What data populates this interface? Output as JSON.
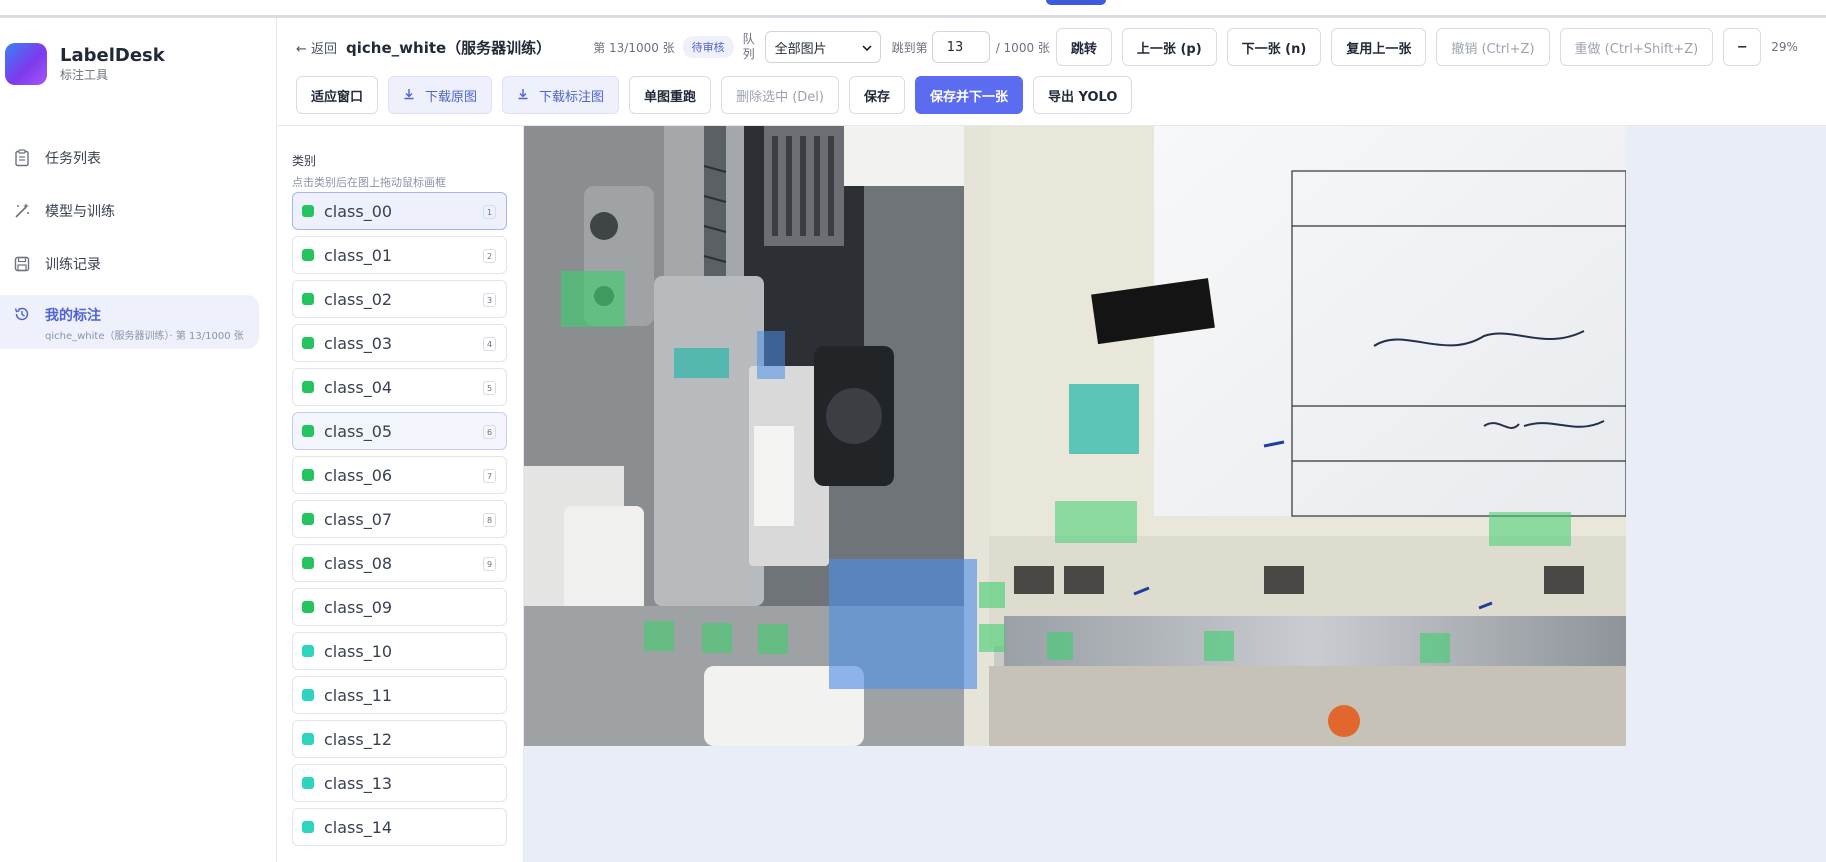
{
  "app": {
    "name": "LabelDesk",
    "subtitle": "标注工具"
  },
  "nav": {
    "items": [
      {
        "label": "任务列表",
        "icon": "clipboard-icon"
      },
      {
        "label": "模型与训练",
        "icon": "magic-wand-icon"
      },
      {
        "label": "训练记录",
        "icon": "save-icon"
      },
      {
        "label": "我的标注",
        "icon": "history-icon",
        "sub": "qiche_white（服务器训练）· 第 13/1000 张"
      }
    ]
  },
  "toolbar": {
    "back": "← 返回",
    "title": "qiche_white（服务器训练）",
    "count": "第 13/1000 张",
    "status_badge": "待审核",
    "queue_label": "队列",
    "queue_value": "全部图片",
    "jump_label": "跳到第",
    "jump_value": "13",
    "total": "/ 1000 张",
    "jump_btn": "跳转",
    "prev_btn": "上一张 (p)",
    "next_btn": "下一张 (n)",
    "reuse_btn": "复用上一张",
    "undo_btn": "撤销 (Ctrl+Z)",
    "redo_btn": "重做 (Ctrl+Shift+Z)",
    "zoom_out": "−",
    "zoom": "29%",
    "fit_btn": "适应窗口",
    "download_orig": "下载原图",
    "download_annot": "下载标注图",
    "rerun_btn": "单图重跑",
    "delete_btn": "删除选中 (Del)",
    "save_btn": "保存",
    "save_next_btn": "保存并下一张",
    "export_btn": "导出 YOLO"
  },
  "classes": {
    "title": "类别",
    "hint": "点击类别后在图上拖动鼠标画框",
    "items": [
      {
        "name": "class_00",
        "key": "1",
        "color": "#22c55e"
      },
      {
        "name": "class_01",
        "key": "2",
        "color": "#22c55e"
      },
      {
        "name": "class_02",
        "key": "3",
        "color": "#22c55e"
      },
      {
        "name": "class_03",
        "key": "4",
        "color": "#22c55e"
      },
      {
        "name": "class_04",
        "key": "5",
        "color": "#22c55e"
      },
      {
        "name": "class_05",
        "key": "6",
        "color": "#22c55e"
      },
      {
        "name": "class_06",
        "key": "7",
        "color": "#22c55e"
      },
      {
        "name": "class_07",
        "key": "8",
        "color": "#22c55e"
      },
      {
        "name": "class_08",
        "key": "9",
        "color": "#22c55e"
      },
      {
        "name": "class_09",
        "key": "",
        "color": "#22c55e"
      },
      {
        "name": "class_10",
        "key": "",
        "color": "#2dd4bf"
      },
      {
        "name": "class_11",
        "key": "",
        "color": "#2dd4bf"
      },
      {
        "name": "class_12",
        "key": "",
        "color": "#2dd4bf"
      },
      {
        "name": "class_13",
        "key": "",
        "color": "#2dd4bf"
      },
      {
        "name": "class_14",
        "key": "",
        "color": "#2dd4bf"
      }
    ]
  },
  "colors": {
    "accent": "#5b6cf0",
    "annot_green": "#3fcf6f",
    "annot_teal": "#19b6a8",
    "annot_blue": "#4d8ee8"
  }
}
